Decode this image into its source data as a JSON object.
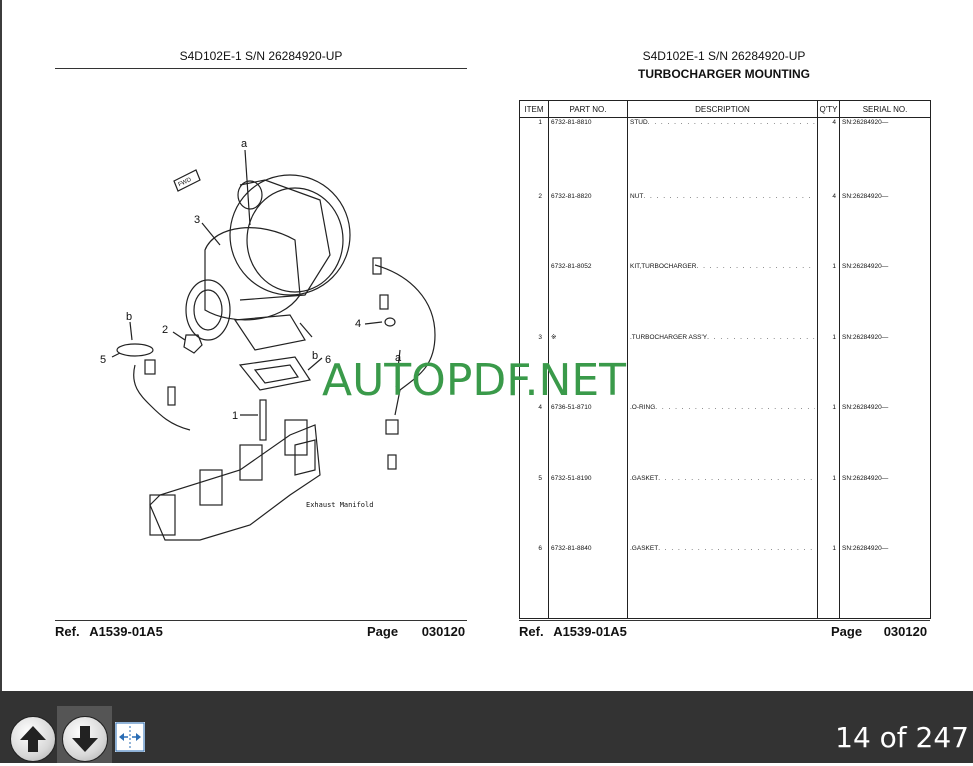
{
  "left_page": {
    "header": "S4D102E-1 S/N 26284920-UP",
    "ref_label": "Ref.",
    "ref_value": "A1539-01A5",
    "page_label": "Page",
    "page_value": "030120",
    "callouts": [
      "a",
      "3",
      "2",
      "b",
      "5",
      "4",
      "b",
      "6",
      "a",
      "1"
    ],
    "manifold_label": "Exhaust Manifold",
    "fwd_label": "FWD"
  },
  "right_page": {
    "header": "S4D102E-1 S/N 26284920-UP",
    "title": "TURBOCHARGER MOUNTING",
    "columns": [
      "ITEM",
      "PART NO.",
      "DESCRIPTION",
      "Q'TY",
      "SERIAL NO."
    ],
    "rows": [
      {
        "item": "1",
        "part": "6732-81-8810",
        "desc": "STUD",
        "qty": "4",
        "serial": "SN:26284920—"
      },
      {
        "item": "2",
        "part": "6732-81-8820",
        "desc": "NUT",
        "qty": "4",
        "serial": "SN:26284920—"
      },
      {
        "item": "",
        "part": "6732-81-8052",
        "desc": "KIT,TURBOCHARGER",
        "qty": "1",
        "serial": "SN:26284920—"
      },
      {
        "item": "3",
        "part": "※",
        "desc": ".TURBOCHARGER ASS'Y",
        "qty": "1",
        "serial": "SN:26284920—"
      },
      {
        "item": "4",
        "part": "6736-51-8710",
        "desc": ".O-RING",
        "qty": "1",
        "serial": "SN:26284920—"
      },
      {
        "item": "5",
        "part": "6732-51-8190",
        "desc": ".GASKET",
        "qty": "1",
        "serial": "SN:26284920—"
      },
      {
        "item": "6",
        "part": "6732-81-8840",
        "desc": ".GASKET",
        "qty": "1",
        "serial": "SN:26284920—"
      }
    ],
    "ref_label": "Ref.",
    "ref_value": "A1539-01A5",
    "page_label": "Page",
    "page_value": "030120"
  },
  "watermark": "AUTOPDF.NET",
  "toolbar": {
    "prev_icon": "arrow-up-icon",
    "next_icon": "arrow-down-icon",
    "fit_icon": "fit-width-icon",
    "page_counter": "14 of 247"
  },
  "colors": {
    "watermark": "#3a9a4a",
    "toolbar_bg": "#333333"
  }
}
